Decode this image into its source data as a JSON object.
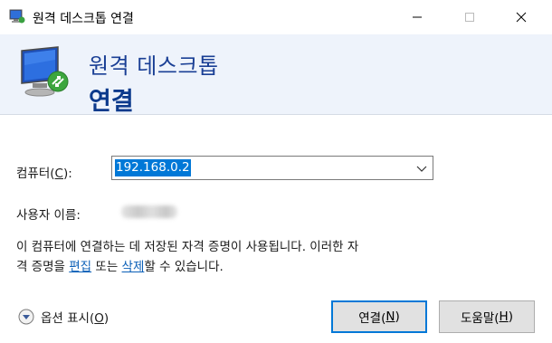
{
  "window": {
    "title": "원격 데스크톱 연결",
    "icon": "remote-desktop-icon",
    "controls": [
      "minimize",
      "maximize",
      "close"
    ]
  },
  "banner": {
    "subtitle": "원격 데스크톱",
    "title": "연결"
  },
  "form": {
    "computer_label_pre": "컴퓨터(",
    "computer_label_key": "C",
    "computer_label_post": "):",
    "computer_value": "192.168.0.2",
    "user_label": "사용자 이름:"
  },
  "info": {
    "line1": "이 컴퓨터에 연결하는 데 저장된 자격 증명이 사용됩니다. 이러한 자",
    "line2_pre": "격 증명을 ",
    "edit_link": "편집",
    "line2_mid": " 또는 ",
    "delete_link": "삭제",
    "line2_post": "할 수 있습니다."
  },
  "footer": {
    "options_pre": "옵션 표시(",
    "options_key": "O",
    "options_post": ")",
    "connect_pre": "연결(",
    "connect_key": "N",
    "connect_post": ")",
    "help_pre": "도움말(",
    "help_key": "H",
    "help_post": ")"
  },
  "colors": {
    "banner_bg": "#eef3fb",
    "banner_text": "#1a3f95",
    "accent": "#0078d7",
    "link": "#0a5fb7"
  }
}
